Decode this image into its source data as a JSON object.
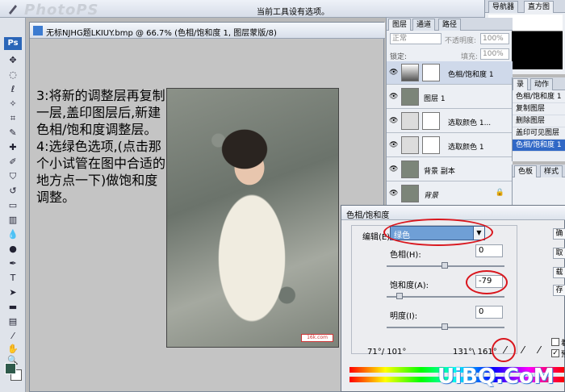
{
  "toolbar": {
    "no_options_text": "当前工具设有选项。",
    "app_badge": "Ps"
  },
  "top_tabs": [
    "导航器",
    "直方图"
  ],
  "document": {
    "title": "无标NJHG题LKIUY.bmp @ 66.7% (色相/饱和度 1, 图层蒙版/8)",
    "instructions": [
      "3:将新的调整层再复制一层,盖印图层后,新建色相/饱和度调整层。",
      "4:选绿色选项,(点击那个小试管在图中合适的地方点一下)做饱和度调整。"
    ],
    "photo_watermark": "16k.com"
  },
  "layers_panel": {
    "tabs": [
      "图层",
      "通道",
      "路径"
    ],
    "blend_mode": "正常",
    "opacity_label": "不透明度:",
    "opacity_value": "100%",
    "lock_label": "锁定:",
    "fill_label": "填充:",
    "fill_value": "100%",
    "layers": [
      {
        "name": "色相/饱和度 1",
        "selected": true,
        "type": "adjustment"
      },
      {
        "name": "图层 1",
        "selected": false,
        "type": "image"
      },
      {
        "name": "选取颜色 1...",
        "selected": false,
        "type": "adjustment"
      },
      {
        "name": "选取颜色 1",
        "selected": false,
        "type": "adjustment"
      },
      {
        "name": "背景 副本",
        "selected": false,
        "type": "image"
      },
      {
        "name": "背景",
        "selected": false,
        "type": "image",
        "locked": true
      }
    ]
  },
  "history_panel": {
    "tabs": [
      "录",
      "动作"
    ],
    "items": [
      "色相/饱和度 1",
      "复制图层",
      "删除图层",
      "盖印可见图层",
      "色相/饱和度 1"
    ]
  },
  "swatch_panel": {
    "tabs": [
      "色板",
      "样式"
    ]
  },
  "hue_sat_dialog": {
    "title": "色相/饱和度",
    "edit_label": "编辑(E):",
    "edit_value": "绿色",
    "hue_label": "色相(H):",
    "hue_value": "0",
    "sat_label": "饱和度(A):",
    "sat_value": "-79",
    "light_label": "明度(I):",
    "light_value": "0",
    "range_left": "71°/ 101°",
    "range_right": "131°\\ 161°",
    "side_buttons": [
      "确",
      "取",
      "载",
      "存"
    ],
    "check_labels": [
      "着",
      "预"
    ]
  },
  "site_logo": "UiBQ.CoM"
}
